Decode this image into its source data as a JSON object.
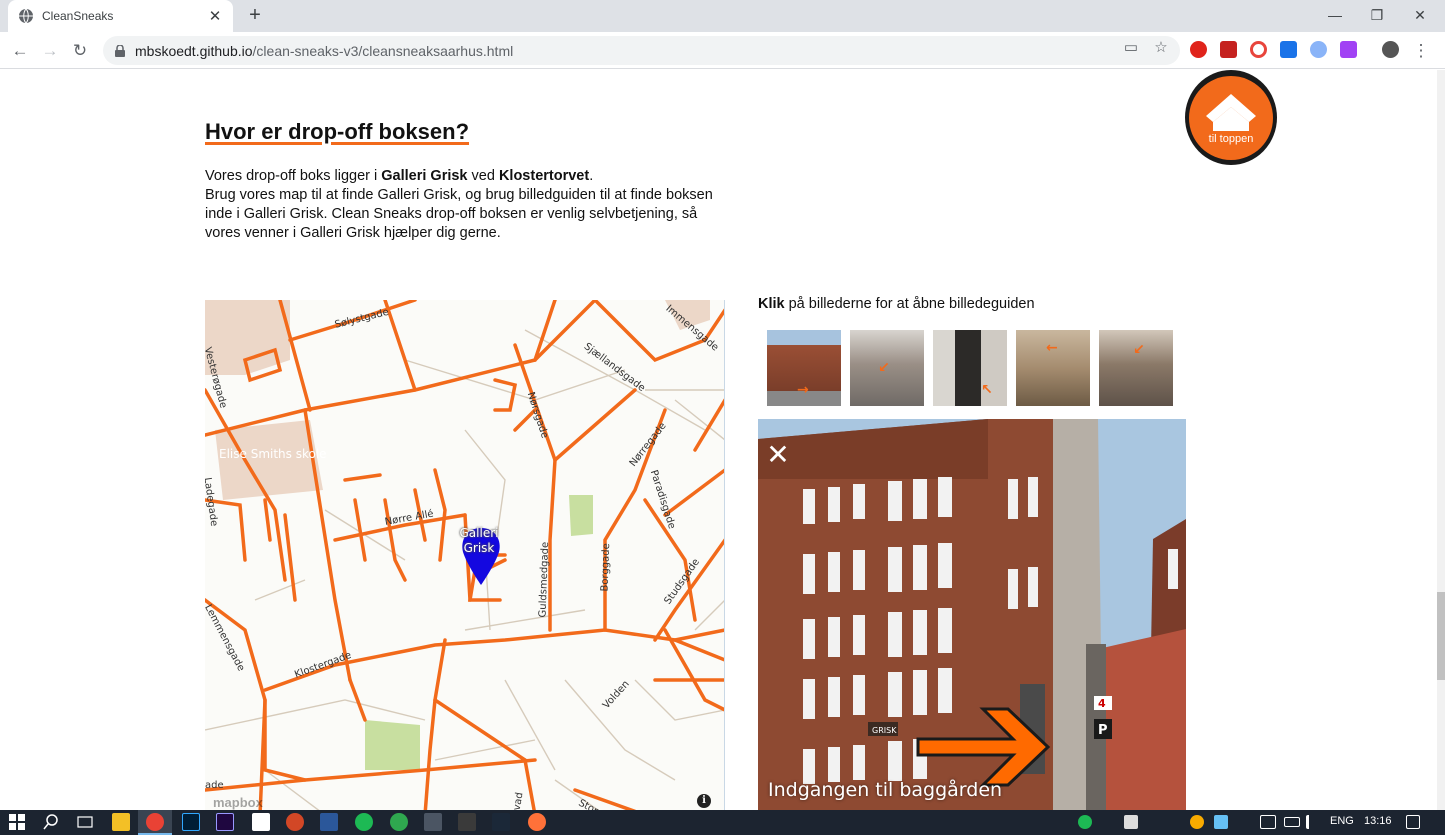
{
  "browser": {
    "tab_title": "CleanSneaks",
    "tab_close": "✕",
    "new_tab": "+",
    "url_host": "mbskoedt.github.io",
    "url_path": "/clean-sneaks-v3/cleansneaksaarhus.html",
    "minimize": "—",
    "restore": "❐",
    "close": "✕"
  },
  "page": {
    "heading": "Hvor er drop-off boksen?",
    "intro": {
      "p1_a": "Vores drop-off boks ligger i ",
      "p1_b": "Galleri Grisk",
      "p1_c": " ved ",
      "p1_d": "Klostertorvet",
      "p1_e": ".",
      "p2": "Brug vores map til at finde Galleri Grisk, og brug billedguiden til at finde boksen inde i Galleri Grisk. Clean Sneaks drop-off boksen er venlig selvbetjening, så vores venner i Galleri Grisk hjælper dig gerne."
    },
    "map": {
      "pin_label": "Galleri Grisk",
      "school_label": "Elise Smiths skole",
      "mapbox_logo": "mapbox",
      "info": "i",
      "streets": [
        {
          "name": "Sølystgade",
          "key": "s1"
        },
        {
          "name": "Sjællandsgade",
          "key": "s2"
        },
        {
          "name": "Nørregade",
          "key": "s3"
        },
        {
          "name": "Paradisgade",
          "key": "s4"
        },
        {
          "name": "Nørre Allé",
          "key": "s5"
        },
        {
          "name": "Nørsgade",
          "key": "s6"
        },
        {
          "name": "Guldsmedgade",
          "key": "s7"
        },
        {
          "name": "Borggade",
          "key": "s8"
        },
        {
          "name": "Studsgade",
          "key": "s9"
        },
        {
          "name": "Klostergade",
          "key": "s10"
        },
        {
          "name": "Volden",
          "key": "s11"
        },
        {
          "name": "Vesterøgade",
          "key": "s12"
        },
        {
          "name": "Lemmensgade",
          "key": "s13"
        },
        {
          "name": "Immensgade",
          "key": "s14"
        },
        {
          "name": "Store Torv",
          "key": "s15"
        },
        {
          "name": "vad",
          "key": "s16"
        },
        {
          "name": "Stor",
          "key": "s17"
        },
        {
          "name": "Ladegade",
          "key": "s18"
        },
        {
          "name": "ade",
          "key": "s19"
        }
      ]
    },
    "guide": {
      "caption_bold": "Klik",
      "caption_rest": " på billederne for at åbne billedeguiden",
      "photo_caption": "Indgangen til baggården",
      "close": "✕",
      "sign_number": "4",
      "sign_parking": "P",
      "sign_grisk": "GRISK"
    },
    "to_top": {
      "label": "til toppen"
    }
  },
  "taskbar": {
    "language": "ENG",
    "time": "13:16"
  }
}
